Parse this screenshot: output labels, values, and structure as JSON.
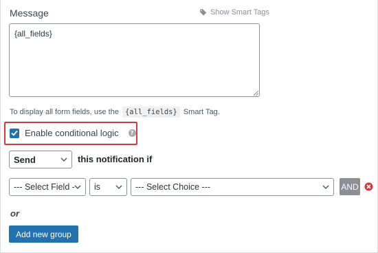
{
  "message": {
    "label": "Message",
    "smart_tags_link": "Show Smart Tags",
    "value": "{all_fields}"
  },
  "help": {
    "prefix": "To display all form fields, use the",
    "code": "{all_fields}",
    "suffix": "Smart Tag."
  },
  "conditional": {
    "checked": true,
    "label": "Enable conditional logic"
  },
  "rule": {
    "action_value": "Send",
    "action_suffix": "this notification if",
    "field_value": "--- Select Field ---",
    "operator_value": "is",
    "choice_value": "--- Select Choice ---",
    "and_label": "AND",
    "or_label": "or",
    "add_group_label": "Add new group"
  },
  "colors": {
    "primary": "#2271b1",
    "highlight": "#e1333c",
    "remove": "#d63638"
  },
  "icons": {
    "smart_tags": "tag-icon",
    "help": "question-circle-icon",
    "remove": "remove-circle-icon",
    "dropdown": "chevron-down-icon"
  }
}
